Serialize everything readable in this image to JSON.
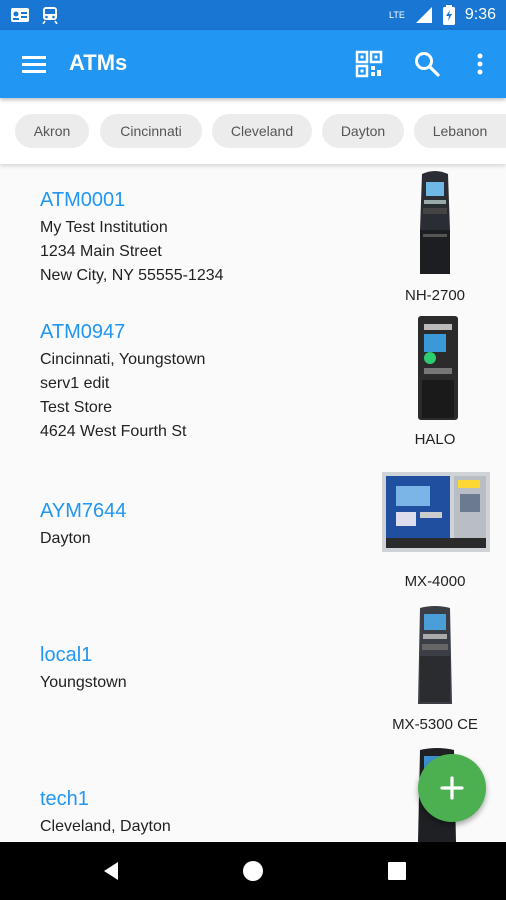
{
  "status_bar": {
    "time": "9:36",
    "network": "LTE"
  },
  "app_bar": {
    "title": "ATMs"
  },
  "filters": [
    "Akron",
    "Cincinnati",
    "Cleveland",
    "Dayton",
    "Lebanon"
  ],
  "atms": [
    {
      "id": "ATM0001",
      "lines": [
        "My Test Institution",
        "1234 Main Street",
        "New City, NY 55555-1234"
      ],
      "model": "NH-2700"
    },
    {
      "id": "ATM0947",
      "lines": [
        "Cincinnati, Youngstown",
        "serv1 edit",
        "Test Store",
        "4624 West Fourth St"
      ],
      "model": "HALO"
    },
    {
      "id": "AYM7644",
      "lines": [
        "Dayton"
      ],
      "model": "MX-4000"
    },
    {
      "id": "local1",
      "lines": [
        "Youngstown"
      ],
      "model": "MX-5300 CE"
    },
    {
      "id": "tech1",
      "lines": [
        "Cleveland, Dayton"
      ],
      "model": ""
    }
  ],
  "colors": {
    "primary": "#2196f3",
    "status": "#1976d2",
    "fab": "#4caf50"
  }
}
